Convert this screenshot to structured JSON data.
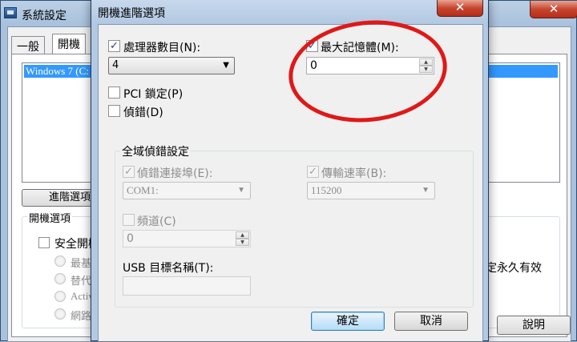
{
  "background_window": {
    "title": "系統設定",
    "close_glyph": "✕",
    "tabs": [
      {
        "label": "一般"
      },
      {
        "label": "開機"
      }
    ],
    "os_list_selected": "Windows 7 (C:",
    "advanced_button": "進階選項",
    "boot_options_group": "開機選項",
    "safe_boot_label": "安全開機",
    "radio_options": [
      "最基",
      "替代",
      "Activ",
      "網路"
    ],
    "permanent_label": "定永久有效",
    "help_button": "說明"
  },
  "dialog": {
    "title": "開機進階選項",
    "close_glyph": "✕",
    "processors": {
      "label": "處理器數目(N):",
      "checked": true,
      "value": "4"
    },
    "max_memory": {
      "label": "最大記憶體(M):",
      "checked": true,
      "value": "0"
    },
    "pci_lock": {
      "label": "PCI 鎖定(P)",
      "checked": false
    },
    "debug": {
      "label": "偵錯(D)",
      "checked": false
    },
    "global_debug": {
      "group_label": "全域偵錯設定",
      "debug_port": {
        "label": "偵錯連接埠(E):",
        "checked": true,
        "value": "COM1:"
      },
      "baud_rate": {
        "label": "傳輸速率(B):",
        "checked": true,
        "value": "115200"
      },
      "channel": {
        "label": "頻道(C)",
        "checked": false,
        "value": "0"
      },
      "usb_target": {
        "label": "USB 目標名稱(T):",
        "value": ""
      }
    },
    "ok_button": "確定",
    "cancel_button": "取消"
  },
  "glyphs": {
    "check": "✓",
    "dropdown": "▼",
    "spin_up": "▲",
    "spin_down": "▼"
  },
  "colors": {
    "annotation": "#e01818",
    "selection": "#3399ff",
    "close_button": "#c7452f"
  }
}
